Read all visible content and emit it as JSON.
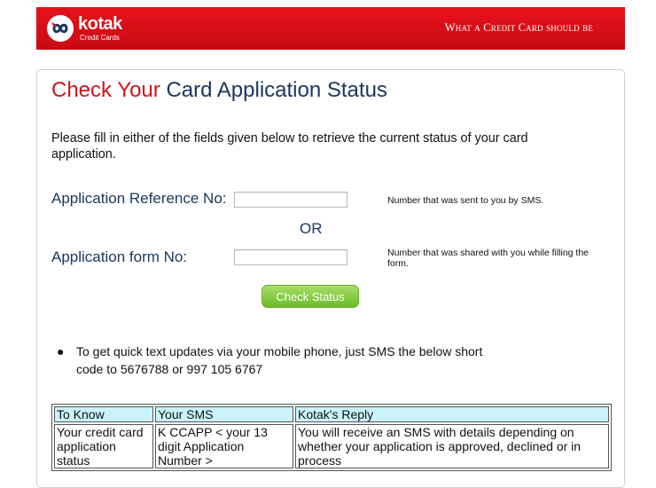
{
  "banner": {
    "brand": "kotak",
    "brand_sub": "Credit Cards",
    "tagline": "What a Credit Card should be",
    "colors": {
      "banner_red": "#d3121b",
      "brand_blue": "#1b365d"
    }
  },
  "page": {
    "title_part1": "Check Your",
    "title_part2": "Card Application Status",
    "intro": "Please fill in either of the fields given below to retrieve the current status of your card application."
  },
  "form": {
    "ref_label": "Application Reference No:",
    "ref_value": "",
    "ref_hint": "Number that was sent to you by SMS.",
    "or_text": "OR",
    "form_label": "Application form No:",
    "form_value": "",
    "form_hint": "Number that was shared with you while filling the form.",
    "submit_label": "Check Status"
  },
  "sms": {
    "info": "To get quick text updates via your mobile phone, just SMS the below short code to 5676788 or 997 105 6767",
    "headers": [
      "To Know",
      "Your SMS",
      "Kotak's Reply"
    ],
    "rows": [
      [
        "Your credit card application status",
        "K CCAPP < your 13 digit Application Number >",
        "You will receive an SMS with details depending on whether your application is approved, declined or in process"
      ]
    ]
  }
}
